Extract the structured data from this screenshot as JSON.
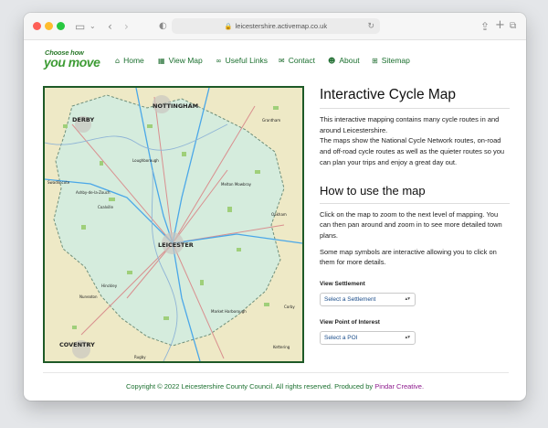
{
  "browser": {
    "url": "leicestershire.activemap.co.uk"
  },
  "brand": {
    "logo_top": "Choose how",
    "logo_main": "you move"
  },
  "nav": {
    "items": [
      {
        "label": "Home",
        "icon": "home-icon"
      },
      {
        "label": "View Map",
        "icon": "map-icon"
      },
      {
        "label": "Useful Links",
        "icon": "link-icon"
      },
      {
        "label": "Contact",
        "icon": "envelope-icon"
      },
      {
        "label": "About",
        "icon": "users-icon"
      },
      {
        "label": "Sitemap",
        "icon": "sitemap-icon"
      }
    ]
  },
  "map": {
    "places": [
      "NOTTINGHAM",
      "DERBY",
      "LEICESTER",
      "COVENTRY",
      "Loughborough",
      "Melton Mowbray",
      "Coalville",
      "Hinckley",
      "Market Harborough",
      "Nuneaton",
      "Rugby",
      "Swadlincote",
      "Ashby-de-la-Zouch",
      "Grantham",
      "Corby",
      "Kettering",
      "Oakham"
    ]
  },
  "content": {
    "title": "Interactive Cycle Map",
    "intro_1": "This interactive mapping contains many cycle routes in and around Leicestershire.",
    "intro_2": "The maps show the National Cycle Network routes, on-road and off-road cycle routes as well as the quieter routes so you can plan your trips and enjoy a great day out.",
    "howto_title": "How to use the map",
    "howto_1": "Click on the map to zoom to the next level of mapping. You can then pan around and zoom in to see more detailed town plans.",
    "howto_2": "Some map symbols are interactive allowing you to click on them for more details.",
    "settlement_label": "View Settlement",
    "settlement_value": "Select a Settlement",
    "poi_label": "View Point of Interest",
    "poi_value": "Select a POI"
  },
  "footer": {
    "copyright": "Copyright © 2022 Leicestershire County Council. All rights reserved. Produced by",
    "producer": "Pindar Creative."
  }
}
